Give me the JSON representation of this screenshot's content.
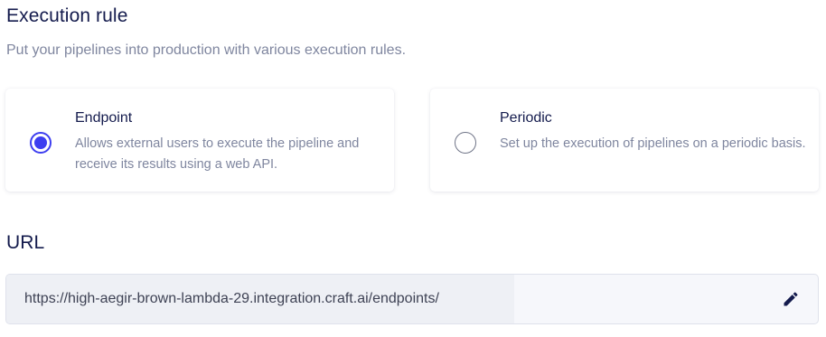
{
  "execution_rule": {
    "title": "Execution rule",
    "subtitle": "Put your pipelines into production with various execution rules.",
    "options": [
      {
        "label": "Endpoint",
        "description": "Allows external users to execute the pipeline and receive its results using a web API.",
        "selected": true
      },
      {
        "label": "Periodic",
        "description": "Set up the execution of pipelines on a periodic basis.",
        "selected": false
      }
    ]
  },
  "url": {
    "title": "URL",
    "value": "https://high-aegir-brown-lambda-29.integration.craft.ai/endpoints/",
    "edit_icon": "pencil-icon"
  },
  "colors": {
    "accent": "#3d3ef0",
    "heading": "#141b4d",
    "muted_text": "#7f869f"
  }
}
